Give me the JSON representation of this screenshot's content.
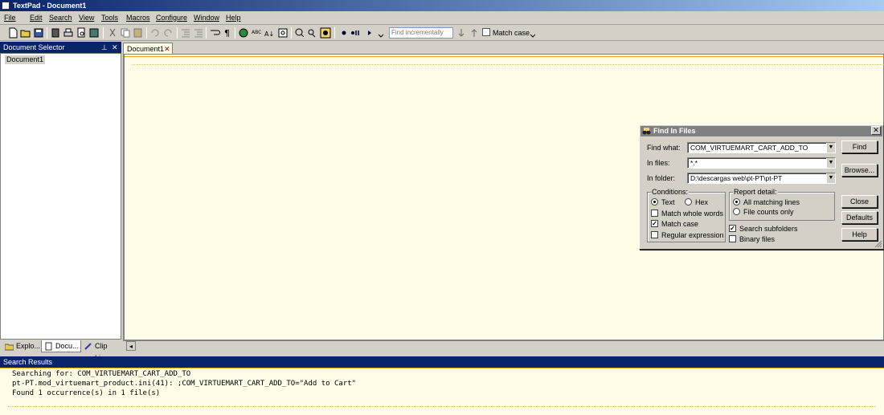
{
  "window": {
    "title": "TextPad - Document1"
  },
  "menu": [
    "File",
    "Edit",
    "Search",
    "View",
    "Tools",
    "Macros",
    "Configure",
    "Window",
    "Help"
  ],
  "toolbar": {
    "find_placeholder": "Find incrementally",
    "match_case_label": "Match case",
    "match_case_checked": false
  },
  "doc_selector": {
    "title": "Document Selector",
    "items": [
      "Document1"
    ],
    "tabs": [
      "Explo...",
      "Docu...",
      "Clip Li..."
    ]
  },
  "editor": {
    "tab": "Document1"
  },
  "results": {
    "title": "Search Results",
    "lines": [
      "Searching for: COM_VIRTUEMART_CART_ADD_TO",
      "pt-PT.mod_virtuemart_product.ini(41): ;COM_VIRTUEMART_CART_ADD_TO=\"Add to Cart\"",
      "Found 1 occurrence(s) in 1 file(s)"
    ]
  },
  "dialog": {
    "title": "Find In Files",
    "find_what_label": "Find what:",
    "find_what_value": "COM_VIRTUEMART_CART_ADD_TO",
    "in_files_label": "In files:",
    "in_files_value": "*.*",
    "in_folder_label": "In folder:",
    "in_folder_value": "D:\\descargas web\\pt-PT\\pt-PT",
    "buttons": {
      "find": "Find",
      "browse": "Browse...",
      "close": "Close",
      "defaults": "Defaults",
      "help": "Help"
    },
    "conditions": {
      "label": "Conditions:",
      "text": "Text",
      "hex": "Hex",
      "match_whole_words": "Match whole words",
      "match_case": "Match case",
      "regular_expression": "Regular expression"
    },
    "report": {
      "label": "Report detail:",
      "all_matching_lines": "All matching lines",
      "file_counts_only": "File counts only"
    },
    "search_subfolders": "Search subfolders",
    "binary_files": "Binary files"
  }
}
